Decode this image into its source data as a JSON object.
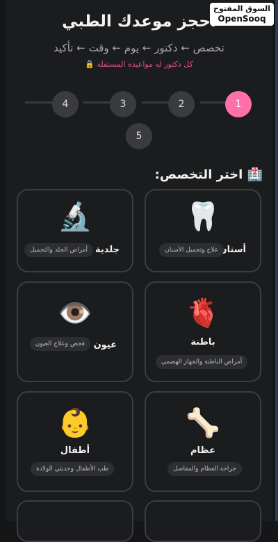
{
  "header": {
    "title": "احجز موعدك الطبي",
    "subtitle": "تخصص ← دكتور ← يوم ← وقت ← تأكيد",
    "note": "🔒 كل دكتور له مواعيده المستقلة",
    "logo_ar": "السوق المفتوح",
    "logo_en": "OpenSooq"
  },
  "steps": [
    "1",
    "2",
    "3",
    "4",
    "5"
  ],
  "active_step": "1",
  "section": {
    "title": "🏥 اختر التخصص:"
  },
  "specialties": [
    {
      "name": "أسنان",
      "desc": "علاج وتجميل الأسنان",
      "icon": "🦷",
      "icon_name": "tooth-icon"
    },
    {
      "name": "جلدية",
      "desc": "أمراض الجلد والتجميل",
      "icon": "🔬",
      "icon_name": "microscope-icon"
    },
    {
      "name": "باطنة",
      "desc": "أمراض الباطنة والجهاز الهضمي",
      "icon": "🫀",
      "icon_name": "heart-organ-icon"
    },
    {
      "name": "عيون",
      "desc": "فحص وعلاج العيون",
      "icon": "👁️",
      "icon_name": "eye-icon"
    },
    {
      "name": "عظام",
      "desc": "جراحة العظام والمفاصل",
      "icon": "🦴",
      "icon_name": "bone-icon"
    },
    {
      "name": "أطفال",
      "desc": "طب الأطفال وحديثي الولادة",
      "icon": "👶",
      "icon_name": "baby-icon"
    }
  ],
  "colors": {
    "accent": "#ff6fa8",
    "note": "#e3508f",
    "background": "#1b1c1e"
  }
}
